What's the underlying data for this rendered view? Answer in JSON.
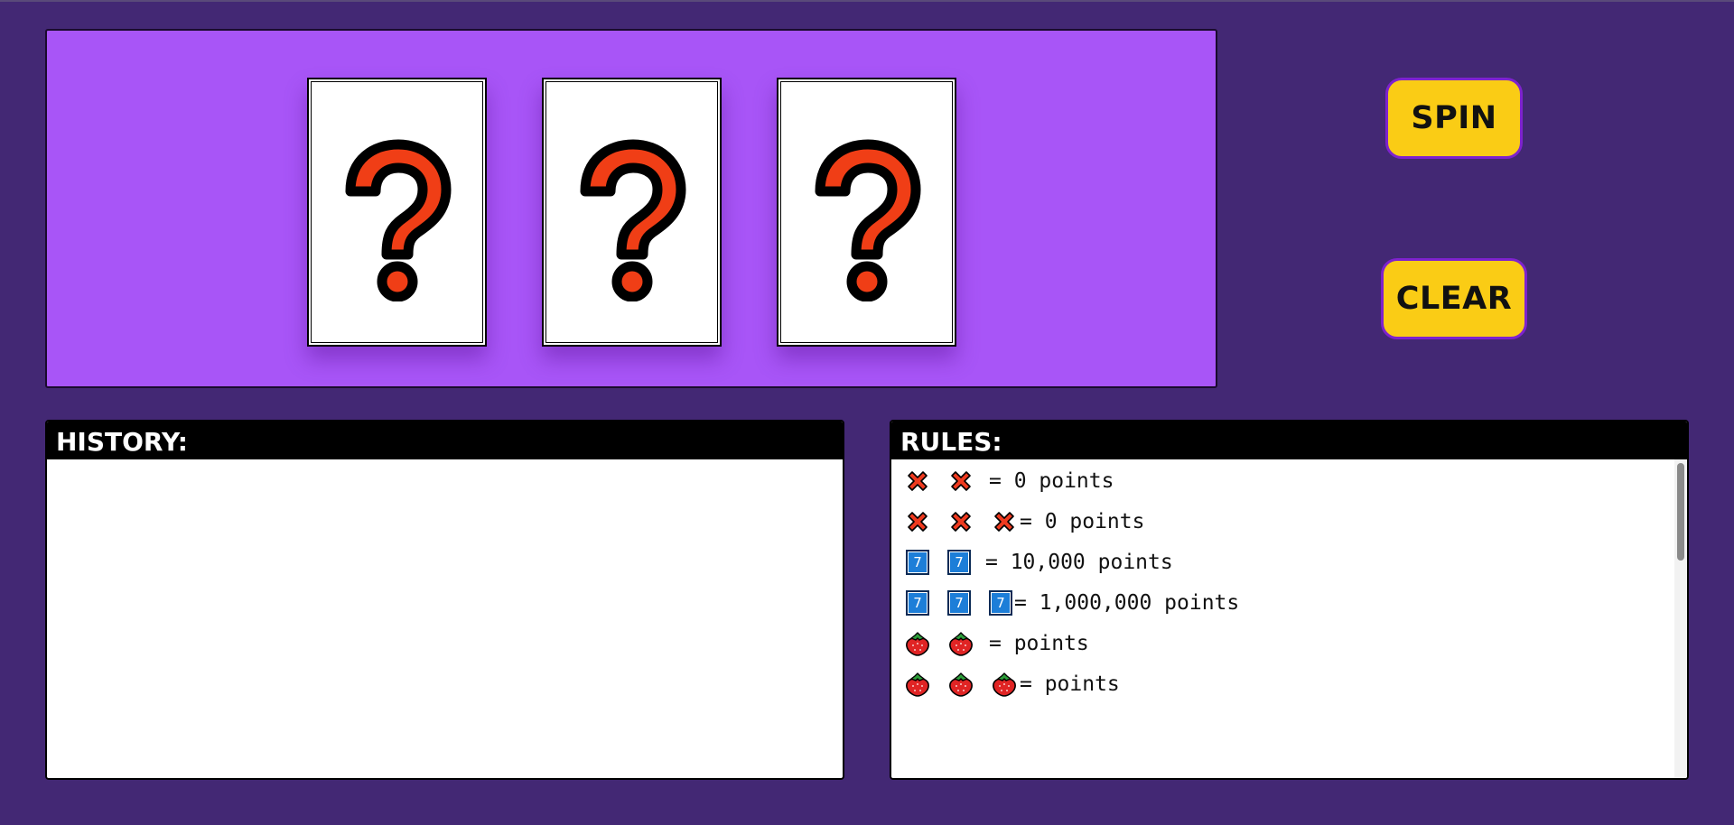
{
  "reels": [
    {
      "symbol": "question-mark"
    },
    {
      "symbol": "question-mark"
    },
    {
      "symbol": "question-mark"
    }
  ],
  "buttons": {
    "spin_label": "SPIN",
    "clear_label": "CLEAR"
  },
  "history": {
    "title": "HISTORY:",
    "entries": []
  },
  "rules": {
    "title": "RULES:",
    "items": [
      {
        "symbols": [
          "cross",
          "cross"
        ],
        "text": "= 0 points"
      },
      {
        "symbols": [
          "cross",
          "cross",
          "cross"
        ],
        "text": "= 0 points"
      },
      {
        "symbols": [
          "seven",
          "seven"
        ],
        "text": "= 10,000 points"
      },
      {
        "symbols": [
          "seven",
          "seven",
          "seven"
        ],
        "text": "= 1,000,000 points"
      },
      {
        "symbols": [
          "strawberry",
          "strawberry"
        ],
        "text": "= points"
      },
      {
        "symbols": [
          "strawberry",
          "strawberry",
          "strawberry"
        ],
        "text": "= points"
      }
    ],
    "seven_label": "7"
  },
  "colors": {
    "background": "#432874",
    "reel_panel": "#a855f7",
    "button": "#facc15",
    "question_mark": "#f03e16"
  }
}
